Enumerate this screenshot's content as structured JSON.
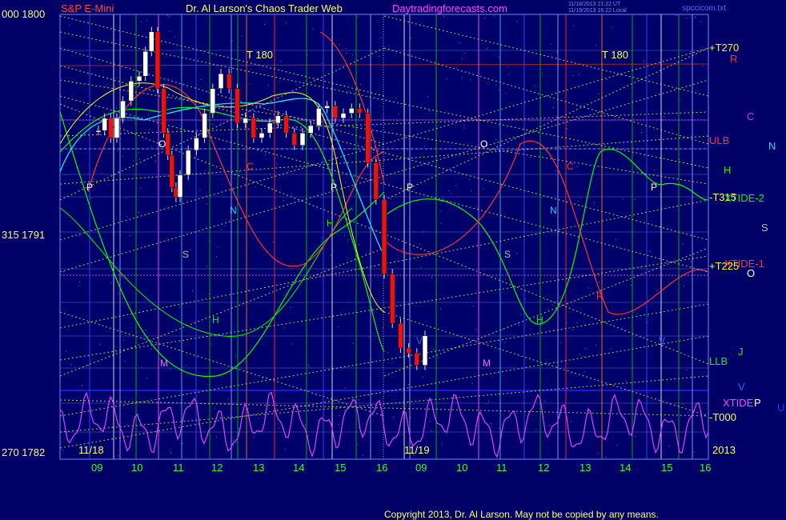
{
  "header": {
    "symbol": "S&P E-Mini",
    "site_title": "Dr. Al Larson's Chaos Trader Web",
    "url": "Daytradingforecasts.com",
    "stamp_line1": "11/18/2013 21:22 UT",
    "stamp_line2": "11/19/2013 16:22 Local",
    "file": "spccicom.txt"
  },
  "left_axis": {
    "top": "000 1800",
    "mid": "315 1791",
    "bottom": "270 1782"
  },
  "right_labels": {
    "t270": "+T270",
    "t315": "-T315",
    "t225": "+T225",
    "t000": "-T000",
    "year": "2013",
    "ulb": "ULB",
    "llb": "LLB",
    "xtide": "XTIDE",
    "xtide2": "XTIDE-2",
    "xtide1": "XTIDE-1"
  },
  "planet_labels": {
    "R": "R",
    "C": "C",
    "N": "N",
    "H": "H",
    "S": "S",
    "O": "O",
    "J": "J",
    "V": "V",
    "P": "P",
    "U": "U",
    "M": "M"
  },
  "t180_label": "T   180",
  "copyright": "Copyright 2013, Dr. Al Larson. May not be copied by any means.",
  "chart_data": {
    "type": "line",
    "title": "S&P E-Mini",
    "y_labels": [
      "1800",
      "1791",
      "1782"
    ],
    "ylim": [
      1782,
      1800
    ],
    "session_dates": [
      "11/18",
      "11/19"
    ],
    "x_hour_ticks": [
      "09",
      "10",
      "11",
      "12",
      "13",
      "14",
      "15",
      "16",
      "09",
      "10",
      "11",
      "12",
      "13",
      "14",
      "15",
      "16"
    ],
    "series": [
      {
        "name": "",
        "color": "#ffffff",
        "points": [
          [
            0,
            1795.3
          ],
          [
            0.15,
            1795.8
          ],
          [
            0.3,
            1795.0
          ],
          [
            0.45,
            1795.8
          ],
          [
            0.6,
            1796.5
          ],
          [
            0.8,
            1797.3
          ],
          [
            1.0,
            1797.5
          ],
          [
            1.15,
            1798.5
          ],
          [
            1.3,
            1799.3
          ],
          [
            1.45,
            1797.0
          ],
          [
            1.6,
            1795.2
          ],
          [
            1.7,
            1794.3
          ],
          [
            1.8,
            1793.0
          ],
          [
            1.9,
            1792.6
          ],
          [
            2.0,
            1793.5
          ],
          [
            2.2,
            1794.5
          ],
          [
            2.4,
            1795.0
          ],
          [
            2.6,
            1796.0
          ],
          [
            2.8,
            1797.0
          ],
          [
            3.0,
            1797.6
          ],
          [
            3.2,
            1797.0
          ],
          [
            3.4,
            1795.6
          ],
          [
            3.6,
            1795.8
          ],
          [
            3.8,
            1795.0
          ],
          [
            4.0,
            1795.2
          ],
          [
            4.2,
            1795.6
          ],
          [
            4.4,
            1795.9
          ],
          [
            4.6,
            1795.2
          ],
          [
            4.8,
            1794.7
          ],
          [
            5.0,
            1795.2
          ],
          [
            5.2,
            1795.5
          ],
          [
            5.4,
            1796.2
          ],
          [
            5.6,
            1796.3
          ],
          [
            5.8,
            1795.8
          ],
          [
            6.0,
            1796.0
          ],
          [
            6.2,
            1796.2
          ],
          [
            6.4,
            1796.0
          ],
          [
            6.6,
            1794.0
          ],
          [
            6.8,
            1792.5
          ],
          [
            7.0,
            1789.5
          ],
          [
            7.2,
            1787.5
          ],
          [
            7.4,
            1786.5
          ],
          [
            7.6,
            1786.3
          ],
          [
            7.8,
            1785.8
          ],
          [
            8.0,
            1787.0
          ]
        ]
      }
    ],
    "ma_colors": [
      "#00ffff",
      "#00ff00",
      "#ffff00"
    ],
    "forecast_colors": [
      "#00ff00",
      "#ff3333",
      "#ff66ff",
      "#ffff00"
    ]
  }
}
